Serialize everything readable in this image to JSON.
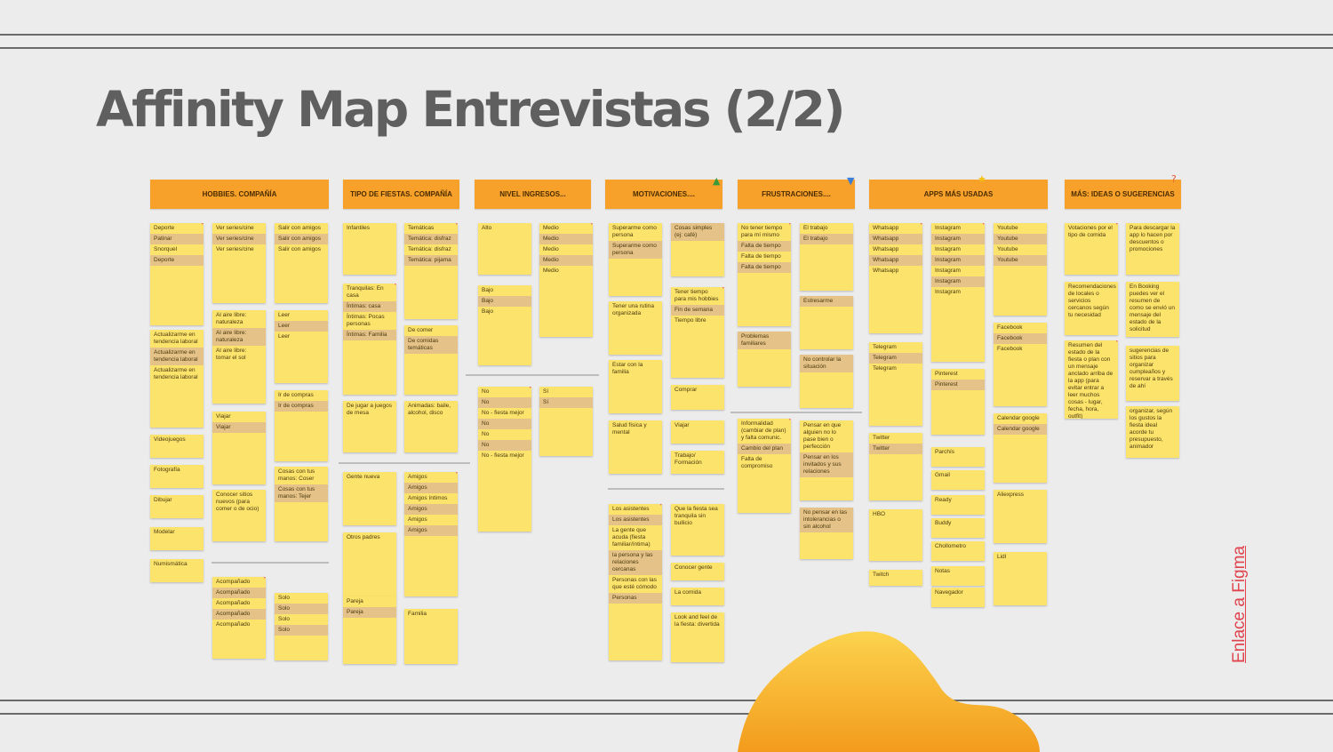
{
  "title": "Affinity Map Entrevistas (2/2)",
  "figma_link": "Enlace a Figma",
  "colors": {
    "header": "#f7a12a",
    "note": "#fce36b",
    "note_tan": "#e5c288",
    "link": "#e0444e",
    "title": "#5f5f5f"
  },
  "columns": [
    {
      "header": "HOBBIES. COMPAÑÍA",
      "badge": "",
      "notes": [
        {
          "lines": [
            "Deporte",
            "Patinar",
            "Snorquel",
            "Deporte"
          ],
          "tan": [
            1,
            3
          ],
          "heart": true
        },
        {
          "lines": [
            "Ver series/cine",
            "Ver series/cine",
            "Ver series/cine"
          ],
          "tan": [
            1
          ]
        },
        {
          "lines": [
            "Salir con amigos",
            "Salir con amigos",
            "Salir con amigos"
          ],
          "tan": [
            1
          ]
        },
        {
          "lines": [
            "Leer",
            "Leer",
            "Leer"
          ],
          "tan": [
            1
          ]
        },
        {
          "lines": [
            "Al aire libre: naturaleza",
            "Al aire libre: naturaleza",
            "Al aire libre: tomar el sol"
          ],
          "tan": [
            1
          ]
        },
        {
          "lines": [
            "Actualizarme en tendencia laboral",
            "Actualizarme en tendencia laboral",
            "Actualizarme en tendencia laboral"
          ],
          "tan": [
            1
          ]
        },
        {
          "lines": [
            "Ir de compras",
            "Ir de compras"
          ],
          "tan": [
            1
          ]
        },
        {
          "lines": [
            "Viajar",
            "Viajar"
          ],
          "tan": [
            1
          ]
        },
        {
          "lines": [
            "Videojuegos"
          ]
        },
        {
          "lines": [
            "Cosas con tus manos: Coser",
            "Cosas con tus manos: Tejer"
          ],
          "tan": [
            1
          ]
        },
        {
          "lines": [
            "Fotografía"
          ]
        },
        {
          "lines": [
            "Conocer sitios nuevos (para comer o de ocio)"
          ]
        },
        {
          "lines": [
            "Dibujar"
          ]
        },
        {
          "lines": [
            "Modelar"
          ]
        },
        {
          "lines": [
            "Numismática"
          ]
        },
        {
          "lines": [
            "Acompañado",
            "Acompañado",
            "Acompañado",
            "Acompañado",
            "Acompañado"
          ],
          "tan": [
            1,
            3
          ],
          "heart": true
        },
        {
          "lines": [
            "Solo",
            "Solo",
            "Solo",
            "Solo"
          ],
          "tan": [
            1,
            3
          ]
        }
      ]
    },
    {
      "header": "TIPO DE FIESTAS. COMPAÑÍA",
      "badge": "",
      "notes": [
        {
          "lines": [
            "Infantiles"
          ]
        },
        {
          "lines": [
            "Temáticas",
            "Temática: disfraz",
            "Temática: disfraz",
            "Temática: pijama"
          ],
          "tan": [
            1,
            3
          ],
          "heart": true
        },
        {
          "lines": [
            "Tranquilas: En casa",
            "Íntimas: casa",
            "Íntimas: Pocas personas",
            "Íntimas: Familia"
          ],
          "tan": [
            1,
            3
          ],
          "heart": true
        },
        {
          "lines": [
            "De comer",
            "De comidas temáticas"
          ],
          "tan": [
            1
          ]
        },
        {
          "lines": [
            "De jugar a juegos de mesa"
          ]
        },
        {
          "lines": [
            "Animadas: baile, alcohol, disco"
          ]
        },
        {
          "lines": [
            "Gente nueva"
          ]
        },
        {
          "lines": [
            "Amigos",
            "Amigos",
            "Amigos íntimos",
            "Amigos",
            "Amigos",
            "Amigos"
          ],
          "tan": [
            1,
            3,
            5
          ],
          "heart": true
        },
        {
          "lines": [
            "Otros padres"
          ]
        },
        {
          "lines": [
            "Pareja",
            "Pareja"
          ],
          "tan": [
            1
          ]
        },
        {
          "lines": [
            "Familia"
          ]
        }
      ]
    },
    {
      "header": "NIVEL INGRESOS...",
      "badge": "",
      "notes": [
        {
          "lines": [
            "Alto"
          ]
        },
        {
          "lines": [
            "Medio",
            "Medio",
            "Medio",
            "Medio",
            "Medio"
          ],
          "tan": [
            1,
            3
          ],
          "heart": true
        },
        {
          "lines": [
            "Bajo",
            "Bajo",
            "Bajo"
          ],
          "tan": [
            1
          ]
        },
        {
          "lines": [
            "No",
            "No",
            "No - fiesta mejor",
            "No",
            "No",
            "No",
            "No - fiesta mejor"
          ],
          "tan": [
            1,
            3,
            5
          ],
          "heart": true
        },
        {
          "lines": [
            "Sí",
            "Sí"
          ],
          "tan": [
            1
          ]
        }
      ]
    },
    {
      "header": "MOTIVACIONES....",
      "badge": "thumbs-up-icon",
      "notes": [
        {
          "lines": [
            "Superarme como persona",
            "Superarme como persona"
          ],
          "tan": [
            1
          ]
        },
        {
          "lines": [
            "Cosas simples (ej: café)"
          ],
          "tan": [
            0
          ]
        },
        {
          "lines": [
            "Tener una rutina organizada"
          ]
        },
        {
          "lines": [
            "Tener tiempo para mis hobbies",
            "Fin de semana",
            "Tiempo libre"
          ],
          "tan": [
            1
          ],
          "heart": true
        },
        {
          "lines": [
            "Estar con la familia"
          ]
        },
        {
          "lines": [
            "Comprar"
          ]
        },
        {
          "lines": [
            "Salud física y mental"
          ]
        },
        {
          "lines": [
            "Viajar"
          ]
        },
        {
          "lines": [
            "Trabajo/ Formación"
          ]
        },
        {
          "lines": [
            "Los asistentes",
            "Los asistentes",
            "La gente que acuda (fiesta familiar/íntima)",
            "la persona y las relaciones cercanas",
            "Personas con las que esté cómodo",
            "Personas"
          ],
          "tan": [
            1,
            3,
            5
          ],
          "heart": true
        },
        {
          "lines": [
            "Que la fiesta sea tranquila sin bullicio"
          ]
        },
        {
          "lines": [
            "Conocer gente"
          ]
        },
        {
          "lines": [
            "La comida"
          ]
        },
        {
          "lines": [
            "Look and feel de la fiesta: divertida"
          ]
        }
      ]
    },
    {
      "header": "FRUSTRACIONES....",
      "badge": "thumbs-down-icon",
      "notes": [
        {
          "lines": [
            "No tener tiempo para mí mismo",
            "Falta de tiempo",
            "Falta de tiempo",
            "Falta de tiempo"
          ],
          "tan": [
            1,
            3
          ],
          "heart": true
        },
        {
          "lines": [
            "El trabajo",
            "El trabajo"
          ],
          "tan": [
            1
          ]
        },
        {
          "lines": [
            "Estresarme"
          ],
          "tan": [
            0
          ]
        },
        {
          "lines": [
            "Problemas familiares"
          ],
          "tan": [
            0
          ]
        },
        {
          "lines": [
            "No controlar la situación"
          ],
          "tan": [
            0
          ]
        },
        {
          "lines": [
            "Informalidad (cambiar de plan) y falta comunic.",
            "Cambio del plan",
            "Falta de compromiso"
          ],
          "tan": [
            1
          ],
          "heart": true
        },
        {
          "lines": [
            "Pensar en que alguien no lo pase bien o perfección",
            "Pensar en los invitados y sus relaciones"
          ],
          "tan": [
            1
          ]
        },
        {
          "lines": [
            "No pensar en las intolerancias o sin alcohol"
          ],
          "tan": [
            0
          ]
        }
      ]
    },
    {
      "header": "APPS MÁS USADAS",
      "badge": "star-icon",
      "notes": [
        {
          "lines": [
            "Whatsapp",
            "Whatsapp",
            "Whatsapp",
            "Whatsapp",
            "Whatsapp"
          ],
          "tan": [
            1,
            3
          ],
          "heart": true
        },
        {
          "lines": [
            "Instagram",
            "Instagram",
            "Instagram",
            "Instagram",
            "Instagram",
            "Instagram",
            "Instagram"
          ],
          "tan": [
            1,
            3,
            5
          ],
          "heart": true
        },
        {
          "lines": [
            "Youtube",
            "Youtube",
            "Youtube",
            "Youtube"
          ],
          "tan": [
            1,
            3
          ]
        },
        {
          "lines": [
            "Telegram",
            "Telegram",
            "Telegram"
          ],
          "tan": [
            1
          ]
        },
        {
          "lines": [
            "Facebook",
            "Facebook",
            "Facebook"
          ],
          "tan": [
            1
          ]
        },
        {
          "lines": [
            "Pinterest",
            "Pinterest"
          ],
          "tan": [
            1
          ]
        },
        {
          "lines": [
            "Calendar google",
            "Calendar google"
          ],
          "tan": [
            1
          ]
        },
        {
          "lines": [
            "Twitter",
            "Twitter"
          ],
          "tan": [
            1
          ]
        },
        {
          "lines": [
            "Parchís"
          ]
        },
        {
          "lines": [
            "Gmail"
          ]
        },
        {
          "lines": [
            "Ready"
          ]
        },
        {
          "lines": [
            "HBO"
          ]
        },
        {
          "lines": [
            "Buddy"
          ]
        },
        {
          "lines": [
            "Aliexpress"
          ]
        },
        {
          "lines": [
            "Chollometro"
          ]
        },
        {
          "lines": [
            "Lidl"
          ]
        },
        {
          "lines": [
            "Notas"
          ]
        },
        {
          "lines": [
            "Twitch"
          ]
        },
        {
          "lines": [
            "Navegador"
          ]
        }
      ]
    },
    {
      "header": "MÁS: IDEAS O SUGERENCIAS",
      "badge": "question-icon",
      "notes": [
        {
          "lines": [
            "Votaciones por el tipo de comida"
          ],
          "heart": true
        },
        {
          "lines": [
            "Para descargar la app lo hacen por descuentos o promociones"
          ]
        },
        {
          "lines": [
            "Recomendaciones de locales o servicios cercanos según tu necesidad"
          ]
        },
        {
          "lines": [
            "En Booking puedes ver el resumen de como se envió un mensaje del estado de la solicitud"
          ]
        },
        {
          "lines": [
            "Resumen del estado de la fiesta o plan con un mensaje anclado arriba de la app (para evitar entrar a leer muchos cosas - lugar, fecha, hora, outfit)"
          ],
          "heart": true
        },
        {
          "lines": [
            "sugerencias de sitios para organizar cumpleaños y reservar a través de ahí"
          ]
        },
        {
          "lines": [
            "organizar, según los gustos la fiesta ideal acorde tu presupuesto, animador"
          ]
        }
      ]
    }
  ]
}
